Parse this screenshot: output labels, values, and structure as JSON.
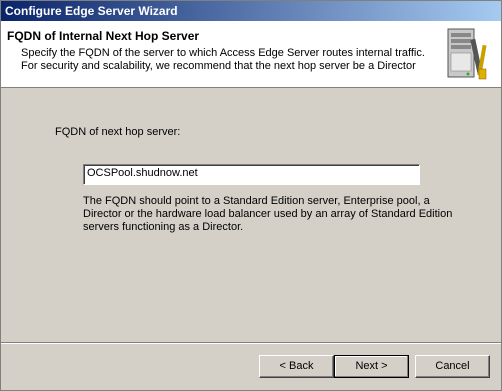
{
  "window": {
    "title": "Configure Edge Server Wizard"
  },
  "header": {
    "title": "FQDN of Internal Next Hop Server",
    "description": "Specify the FQDN of the server to which Access Edge Server routes internal traffic. For security and scalability, we recommend that the next hop server be a Director",
    "icon": "server-tools-icon"
  },
  "form": {
    "fqdn_label": "FQDN of next hop server:",
    "fqdn_value": "OCSPool.shudnow.net",
    "help_text": "The FQDN should point to a Standard Edition server, Enterprise pool, a Director or the hardware load balancer used by an array of Standard Edition servers functioning as a Director."
  },
  "buttons": {
    "back": "< Back",
    "next": "Next >",
    "cancel": "Cancel"
  }
}
